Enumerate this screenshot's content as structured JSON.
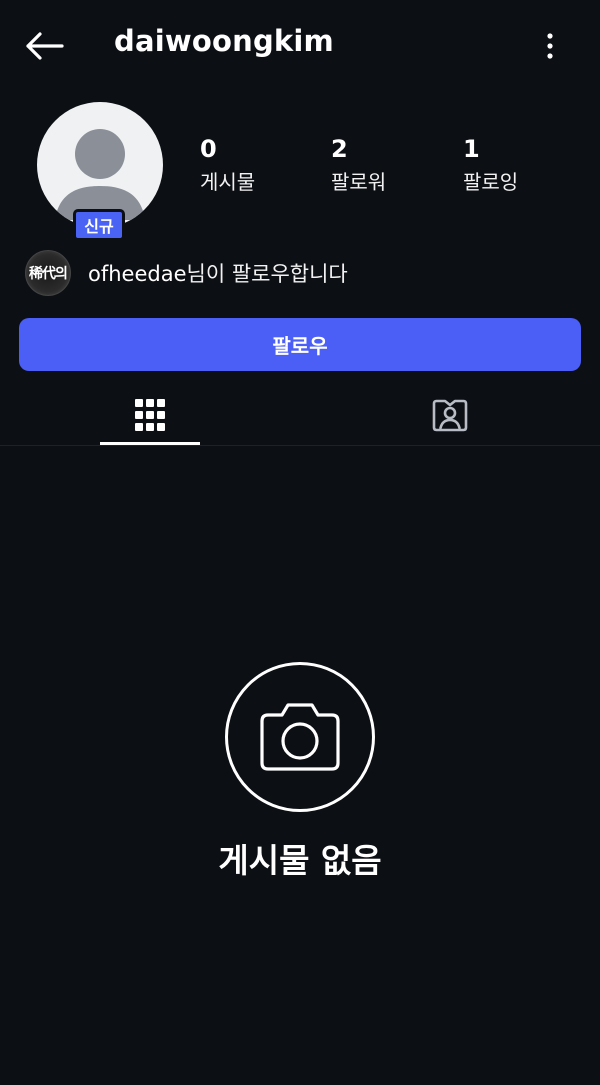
{
  "header": {
    "username": "daiwoongkim",
    "back_icon": "arrow-left-icon",
    "more_icon": "more-vertical-icon"
  },
  "profile": {
    "badge": "신규",
    "stats": [
      {
        "value": "0",
        "label": "게시물"
      },
      {
        "value": "2",
        "label": "팔로워"
      },
      {
        "value": "1",
        "label": "팔로잉"
      }
    ]
  },
  "mutual": {
    "avatar_text": "稀代의",
    "username": "ofheedae",
    "suffix": "님이 팔로우합니다"
  },
  "actions": {
    "follow_label": "팔로우"
  },
  "tabs": [
    {
      "icon": "grid-icon",
      "active": true
    },
    {
      "icon": "tagged-user-icon",
      "active": false
    }
  ],
  "empty_state": {
    "icon": "camera-icon",
    "text": "게시물 없음"
  },
  "colors": {
    "background": "#0c0f14",
    "accent": "#4b5ef6",
    "badge": "#4b63f5",
    "text": "#ffffff"
  }
}
